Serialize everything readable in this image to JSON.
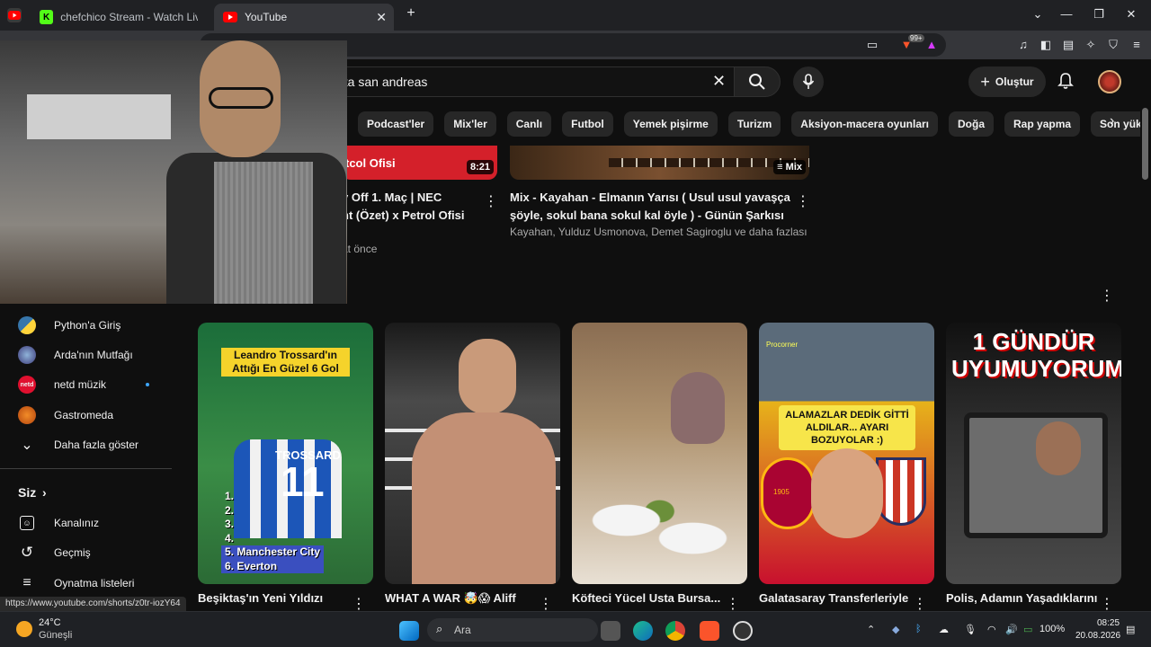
{
  "browser": {
    "tabs": [
      {
        "title": "chefchico Stream - Watch Live on Kick",
        "active": false
      },
      {
        "title": "YouTube",
        "active": true
      }
    ],
    "new_tab_label": "+",
    "extension_badge": "99+"
  },
  "youtube": {
    "search": {
      "query": "gta san andreas"
    },
    "create_label": "Oluştur",
    "chips": [
      "Podcast'ler",
      "Mix'ler",
      "Canlı",
      "Futbol",
      "Yemek pişirme",
      "Turizm",
      "Aksiyon-macera oyunları",
      "Doğa",
      "Rap yapma",
      "Son yüklenenler"
    ],
    "top_videos": [
      {
        "thumb_text": "tcol Ofisi",
        "duration": "8:21",
        "title_line1": "y Off 1. Maç | NEC",
        "title_line2": "nt (Özet) x Petrol Ofisi",
        "meta": "at önce"
      },
      {
        "badge": "Mix",
        "title_line1": "Mix - Kayahan - Elmanın Yarısı ( Usul usul yavaşça",
        "title_line2": "şöyle, sokul bana sokul kal öyle ) - Günün Şarkısı",
        "meta": "Kayahan, Yulduz Usmonova, Demet Sagiroglu ve daha fazlası"
      }
    ],
    "sidebar": {
      "subscriptions": [
        {
          "label": "Python'a Giriş",
          "icon": "python-logo"
        },
        {
          "label": "Arda'nın Mutfağı",
          "icon": "channel-avatar"
        },
        {
          "label": "netd müzik",
          "icon": "netd-logo",
          "new": true
        },
        {
          "label": "Gastromeda",
          "icon": "channel-avatar"
        }
      ],
      "show_more": "Daha fazla göster",
      "you_header": "Siz",
      "you_items": [
        "Kanalınız",
        "Geçmiş",
        "Oynatma listeleri"
      ]
    },
    "shorts": [
      {
        "title": "Beşiktaş'ın Yeni Yıldızı",
        "overlay_top": "Leandro Trossard'ın Attığı En Güzel 6 Gol",
        "list": [
          "1.",
          "2.",
          "3.",
          "4.",
          "5. Manchester City",
          "6. Everton"
        ],
        "jersey": "11",
        "jersey_name": "TROSSARD"
      },
      {
        "title": "WHAT A WAR 🤯😱 Aliff",
        "overlay_top": ""
      },
      {
        "title": "Köfteci Yücel Usta Bursa...",
        "overlay_top": ""
      },
      {
        "title": "Galatasaray Transferleriyle",
        "overlay_top": "ALAMAZLAR DEDİK GİTTİ ALDILAR... AYARI BOZUYOLAR :)",
        "tag": "Procorner",
        "badge_year": "1905"
      },
      {
        "title": "Polis, Adamın Yaşadıklarını",
        "overlay_top": "1 GÜNDÜR UYUMUYORUM"
      }
    ],
    "status_url": "https://www.youtube.com/shorts/z0tr-iozY64"
  },
  "taskbar": {
    "weather_temp": "24°C",
    "weather_desc": "Güneşli",
    "search_label": "Ara",
    "battery": "100%",
    "time": "08:25",
    "date": "20.08.2026"
  },
  "colors": {
    "yt_bg": "#0f0f0f",
    "chip_bg": "#272727",
    "red": "#ff0000"
  }
}
